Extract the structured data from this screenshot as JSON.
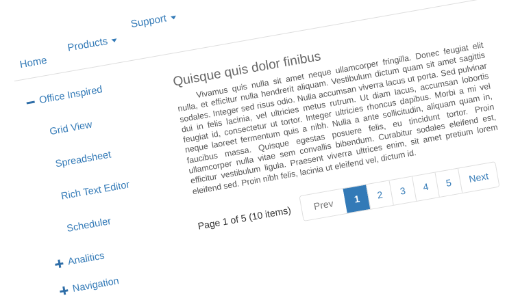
{
  "nav": {
    "home": "Home",
    "products": "Products",
    "support": "Support"
  },
  "sidebar": {
    "items": [
      {
        "label": "Office Inspired",
        "icon": "minus-icon"
      },
      {
        "label": "Grid View"
      },
      {
        "label": "Spreadsheet"
      },
      {
        "label": "Rich Text Editor"
      },
      {
        "label": "Scheduler"
      },
      {
        "label": "Analitics",
        "icon": "plus-icon"
      },
      {
        "label": "Navigation",
        "icon": "plus-icon"
      }
    ]
  },
  "main": {
    "title": "Quisque quis dolor finibus",
    "paragraph": "Vivamus quis nulla sit amet neque ullamcorper fringilla. Donec feugiat elit nulla, et efficitur nulla hendrerit aliquam. Vestibulum dictum quam sit amet sagittis sodales. Integer sed risus odio. Nulla accumsan viverra lacus ut porta. Sed pulvinar dui in felis lacinia, vel ultricies metus rutrum. Ut diam lacus, accumsan lobortis feugiat id, consectetur ut tortor. Integer ultricies rhoncus dapibus. Morbi a mi vel neque laoreet fermentum quis a nibh. Nulla a ante sollicitudin, aliquam quam in, faucibus massa. Quisque egestas posuere felis, eu tincidunt tortor. Proin ullamcorper nulla vitae sem convallis bibendum. Curabitur sodales eleifend est, efficitur vestibulum ligula. Praesent viverra ultrices enim, sit amet pretium lorem eleifend sed. Proin nibh felis, lacinia ut eleifend vel, dictum id."
  },
  "pager": {
    "summary": "Page 1 of 5 (10 items)",
    "prev": "Prev",
    "next": "Next",
    "pages": [
      "1",
      "2",
      "3",
      "4",
      "5"
    ],
    "current": "1"
  },
  "colors": {
    "link": "#337ab7",
    "active_page": "#337ab7"
  }
}
